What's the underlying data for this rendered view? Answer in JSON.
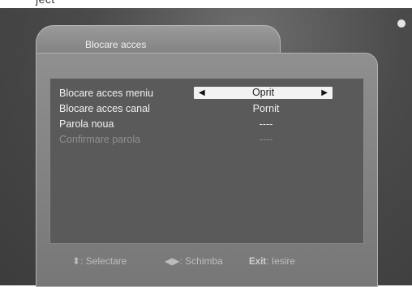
{
  "crop_text": "ject",
  "title": "Blocare acces",
  "rows": [
    {
      "label": "Blocare acces meniu",
      "value": "Oprit"
    },
    {
      "label": "Blocare acces canal",
      "value": "Pornit"
    },
    {
      "label": "Parola noua",
      "value": "----"
    },
    {
      "label": "Confirmare parola",
      "value": "----"
    }
  ],
  "footer": {
    "select_label": ": Selectare",
    "change_label": ": Schimba",
    "exit_key": "Exit",
    "exit_label": ": Iesire"
  },
  "icons": {
    "left_arrow": "triangle-left",
    "right_arrow": "triangle-right",
    "updown": "up-down-arrows",
    "leftright": "left-right-arrows"
  }
}
